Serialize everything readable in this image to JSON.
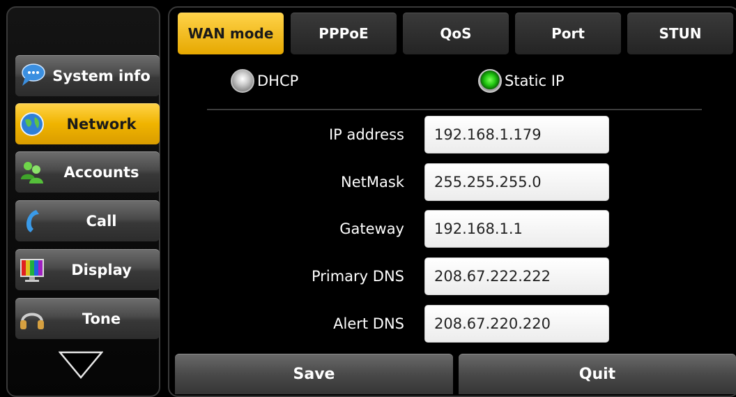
{
  "sidebar": {
    "items": [
      {
        "label": "System info",
        "icon": "chat-bubble-icon",
        "active": false
      },
      {
        "label": "Network",
        "icon": "globe-icon",
        "active": true
      },
      {
        "label": "Accounts",
        "icon": "users-icon",
        "active": false
      },
      {
        "label": "Call",
        "icon": "phone-handset-icon",
        "active": false
      },
      {
        "label": "Display",
        "icon": "monitor-icon",
        "active": false
      },
      {
        "label": "Tone",
        "icon": "headphones-icon",
        "active": false
      }
    ],
    "scroll_icon": "triangle-down-icon"
  },
  "tabs": [
    {
      "label": "WAN mode",
      "active": true
    },
    {
      "label": "PPPoE",
      "active": false
    },
    {
      "label": "QoS",
      "active": false
    },
    {
      "label": "Port",
      "active": false
    },
    {
      "label": "STUN",
      "active": false
    }
  ],
  "wan": {
    "options": [
      {
        "label": "DHCP",
        "selected": false
      },
      {
        "label": "Static IP",
        "selected": true
      }
    ]
  },
  "fields": [
    {
      "label": "IP address",
      "value": "192.168.1.179"
    },
    {
      "label": "NetMask",
      "value": "255.255.255.0"
    },
    {
      "label": "Gateway",
      "value": "192.168.1.1"
    },
    {
      "label": "Primary DNS",
      "value": "208.67.222.222"
    },
    {
      "label": "Alert DNS",
      "value": "208.67.220.220"
    }
  ],
  "actions": {
    "save_label": "Save",
    "quit_label": "Quit"
  },
  "colors": {
    "accent": "#f0b400",
    "background": "#000000",
    "radio_on": "#22c812"
  }
}
